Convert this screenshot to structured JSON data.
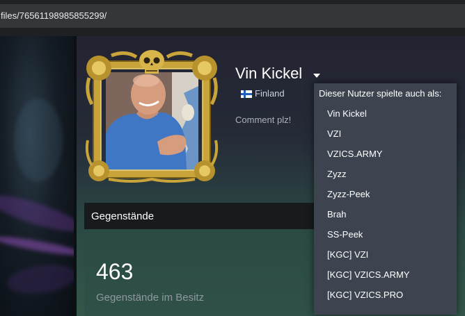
{
  "browser": {
    "url_fragment": "files/76561198985855299/"
  },
  "profile": {
    "name": "Vin Kickel",
    "country": "Finland",
    "summary": "Comment plz!"
  },
  "items_panel": {
    "title": "Gegenstände",
    "count": "463",
    "count_label": "Gegenstände im Besitz"
  },
  "name_history": {
    "header": "Dieser Nutzer spielte auch als:",
    "names": [
      "Vin Kickel",
      "VZI",
      "VZICS.ARMY",
      "Zyzz",
      "Zyzz-Peek",
      "Brah",
      "SS-Peek",
      "[KGC] VZI",
      "[KGC] VZICS.ARMY",
      "[KGC] VZICS.PRO"
    ]
  },
  "colors": {
    "accent_gold": "#c9a43a",
    "dropdown_bg": "#3d4450",
    "flag_blue": "#1d5fc2"
  },
  "icons": {
    "dropdown": "caret-down-icon",
    "country_flag": "finland-flag-icon",
    "frame_ornament": "skull-ornament-icon"
  }
}
